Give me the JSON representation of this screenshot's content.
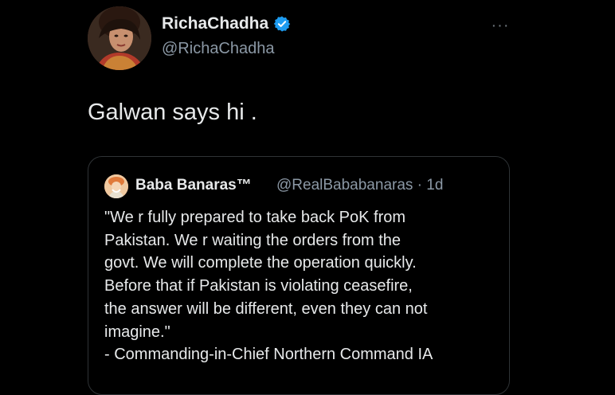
{
  "tweet": {
    "author_name": "RichaChadha",
    "author_handle": "@RichaChadha",
    "verified_icon": "verified-badge-icon",
    "more_icon": "more-options-icon",
    "more_label": "···",
    "text": "Galwan says hi ."
  },
  "quote": {
    "author_name": "Baba Banaras™",
    "author_handle": "@RealBababanaras · 1d",
    "lines": [
      "\"We r fully prepared to take back PoK from",
      "Pakistan. We r waiting the orders from the",
      "govt. We will complete the operation quickly.",
      "Before that if Pakistan is violating ceasefire,",
      "the answer will be different, even they can not",
      "imagine.\"",
      "- Commanding-in-Chief Northern Command IA"
    ]
  },
  "colors": {
    "background": "#000000",
    "text_primary": "#e7e9ea",
    "text_secondary": "#8b98a5",
    "verified": "#1d9bf0",
    "border": "#2f3336"
  }
}
